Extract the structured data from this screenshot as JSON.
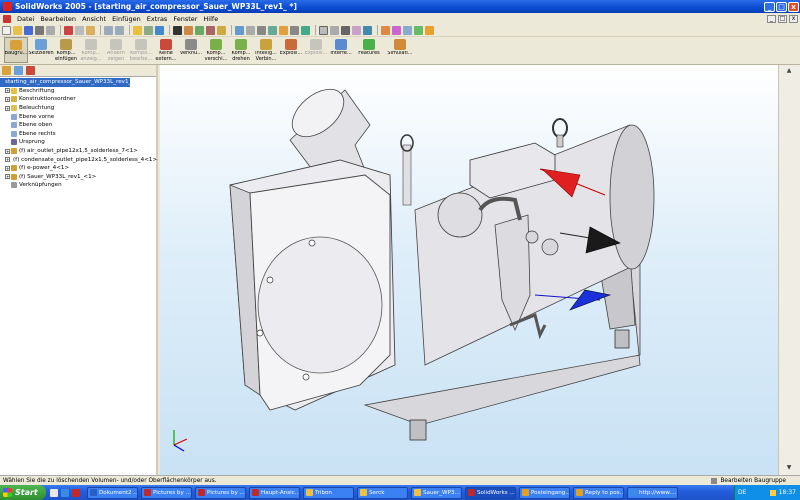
{
  "window": {
    "title": "SolidWorks 2005 - [starting_air_compressor_Sauer_WP33L_rev1_ *]",
    "min": "_",
    "max": "□",
    "close": "x"
  },
  "menu": [
    "Datei",
    "Bearbeiten",
    "Ansicht",
    "Einfügen",
    "Extras",
    "Fenster",
    "Hilfe"
  ],
  "doc_controls": [
    "_",
    "□",
    "x"
  ],
  "commands": [
    {
      "label": "Baugru...",
      "disabled": false,
      "pressed": true,
      "color": "#d9a13a"
    },
    {
      "label": "Skizzieren",
      "disabled": false,
      "pressed": false,
      "color": "#6aa0d8"
    },
    {
      "label": "Komp...\neinfügen",
      "disabled": false,
      "pressed": false,
      "color": "#b89b4a"
    },
    {
      "label": "Komp...\nanzeig...",
      "disabled": true,
      "pressed": false,
      "color": "#999"
    },
    {
      "label": "Ändern\nzeigen",
      "disabled": true,
      "pressed": false,
      "color": "#999"
    },
    {
      "label": "Kompo...\nbearbe...",
      "disabled": true,
      "pressed": false,
      "color": "#999"
    },
    {
      "label": "Keine\nextern...",
      "disabled": false,
      "pressed": false,
      "color": "#c94a3a"
    },
    {
      "label": "Verknü...",
      "disabled": false,
      "pressed": false,
      "color": "#8a8a8a"
    },
    {
      "label": "Komp...\nverschi...",
      "disabled": false,
      "pressed": false,
      "color": "#7ab04a"
    },
    {
      "label": "Komp...\ndrehen",
      "disabled": false,
      "pressed": false,
      "color": "#7ab04a"
    },
    {
      "label": "Intellig...\nVerbin...",
      "disabled": false,
      "pressed": false,
      "color": "#c8a23a"
    },
    {
      "label": "Explosi...",
      "disabled": false,
      "pressed": false,
      "color": "#c86a3a"
    },
    {
      "label": "Explosi...",
      "disabled": true,
      "pressed": false,
      "color": "#999"
    },
    {
      "label": "Interfe...",
      "disabled": false,
      "pressed": false,
      "color": "#5a8ad0"
    },
    {
      "label": "Features",
      "disabled": false,
      "pressed": false,
      "color": "#4ab04a",
      "dropdown": true
    },
    {
      "label": "Simulati...",
      "disabled": false,
      "pressed": false,
      "color": "#d08a3a",
      "dropdown": true
    }
  ],
  "tree": [
    {
      "label": "starting_air_compressor_Sauer_WP33L_rev1_",
      "indent": 0,
      "exp": "",
      "color": "#d9a13a",
      "selected": true
    },
    {
      "label": "Beschriftung",
      "indent": 1,
      "exp": "+",
      "color": "#e8c040",
      "selected": false
    },
    {
      "label": "Konstruktionsordner",
      "indent": 1,
      "exp": "+",
      "color": "#d8b040",
      "selected": false
    },
    {
      "label": "Beleuchtung",
      "indent": 1,
      "exp": "+",
      "color": "#e0c050",
      "selected": false
    },
    {
      "label": "Ebene vorne",
      "indent": 1,
      "exp": "",
      "color": "#8aa8d0",
      "selected": false
    },
    {
      "label": "Ebene oben",
      "indent": 1,
      "exp": "",
      "color": "#8aa8d0",
      "selected": false
    },
    {
      "label": "Ebene rechts",
      "indent": 1,
      "exp": "",
      "color": "#8aa8d0",
      "selected": false
    },
    {
      "label": "Ursprung",
      "indent": 1,
      "exp": "",
      "color": "#6a6a9a",
      "selected": false
    },
    {
      "label": "(f) air_outlet_pipe12x1,5_solderless_7<1>",
      "indent": 1,
      "exp": "+",
      "color": "#d0a030",
      "selected": false
    },
    {
      "label": "(f) condensate_outlet_pipe12x1,5_solderless_4<1>",
      "indent": 1,
      "exp": "+",
      "color": "#d0a030",
      "selected": false
    },
    {
      "label": "(f) e-power_4<1>",
      "indent": 1,
      "exp": "+",
      "color": "#d0a030",
      "selected": false
    },
    {
      "label": "(f) Sauer_WP33L_rev1_<1>",
      "indent": 1,
      "exp": "+",
      "color": "#d0a030",
      "selected": false
    },
    {
      "label": "Verknüpfungen",
      "indent": 1,
      "exp": "",
      "color": "#9a9a9a",
      "selected": false
    }
  ],
  "status": {
    "left": "Wählen Sie die zu löschenden Volumen- und/oder Oberflächenkörper aus.",
    "right": "Bearbeiten Baugruppe"
  },
  "taskbar": {
    "start": "Start",
    "tasks": [
      {
        "label": "Dokument2 ...",
        "color": "#2a5fc8",
        "active": false
      },
      {
        "label": "Pictures by ...",
        "color": "#c0282a",
        "active": false
      },
      {
        "label": "Pictures by ...",
        "color": "#c0282a",
        "active": false
      },
      {
        "label": "Haupt-Ansic...",
        "color": "#c0282a",
        "active": false
      },
      {
        "label": "Tribon",
        "color": "#f0c040",
        "active": false
      },
      {
        "label": "Serck",
        "color": "#f0c040",
        "active": false
      },
      {
        "label": "Sauer_WP3...",
        "color": "#f0c040",
        "active": false
      },
      {
        "label": "SolidWorks ...",
        "color": "#c0282a",
        "active": true
      },
      {
        "label": "Posteingang...",
        "color": "#e0a020",
        "active": false
      },
      {
        "label": "Reply to pos...",
        "color": "#e0a020",
        "active": false
      },
      {
        "label": "http://www....",
        "color": "#3a8ae8",
        "active": false
      }
    ],
    "lang": "DE",
    "time": "18:37"
  }
}
